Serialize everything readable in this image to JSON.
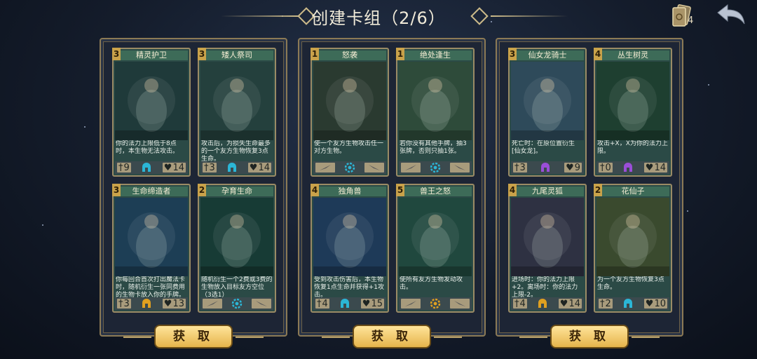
{
  "header": {
    "title": "创建卡组（2/6）",
    "deck_count": "4"
  },
  "colors": {
    "accent_gold": "#e5b44b",
    "card_frame": "#9a8b65",
    "blue_class": "#2bb6d6",
    "orange_class": "#e0a020",
    "purple_class": "#9a4ed8"
  },
  "decks": [
    {
      "button_label": "获 取",
      "cards": [
        {
          "cost": "3",
          "name": "精灵护卫",
          "text": "你的法力上限低于8点时，本生物无法攻击。",
          "attack": "9",
          "class_icon": "blue-helmet-icon",
          "health": "14"
        },
        {
          "cost": "3",
          "name": "矮人祭司",
          "text": "攻击后，为损失生命最多的一个友方生物恢复3点生命。",
          "attack": "3",
          "class_icon": "blue-helmet-icon",
          "health": "14"
        },
        {
          "cost": "3",
          "name": "生命缔造者",
          "text": "你每回合首次打出魔法卡时，随机衍生一张同费用的生物卡放入你的手牌。",
          "attack": "3",
          "class_icon": "orange-helmet-icon",
          "health": "13"
        },
        {
          "cost": "2",
          "name": "孕育生命",
          "text": "随机衍生一个2费或3费的生物放入目标友方空位（3选1）",
          "spell": true,
          "class_icon": "blue-gear-icon"
        }
      ]
    },
    {
      "button_label": "获 取",
      "cards": [
        {
          "cost": "1",
          "name": "怒袭",
          "text": "使一个友方生物攻击任一对方生物。",
          "spell": true,
          "class_icon": "blue-gear-icon"
        },
        {
          "cost": "1",
          "name": "绝处逢生",
          "text": "若你没有其他手牌，抽3张牌，否则只抽1张。",
          "spell": true,
          "class_icon": "blue-gear-icon"
        },
        {
          "cost": "4",
          "name": "独角兽",
          "text": "受到攻击伤害后，本生物恢复1点生命并获得+1攻击。",
          "attack": "4",
          "class_icon": "blue-helmet-icon",
          "health": "15"
        },
        {
          "cost": "5",
          "name": "兽王之怒",
          "text": "使所有友方生物发动攻击。",
          "spell": true,
          "class_icon": "orange-gear-icon"
        }
      ]
    },
    {
      "button_label": "获 取",
      "cards": [
        {
          "cost": "3",
          "name": "仙女龙骑士",
          "text": "死亡时：在原位置衍生[仙女龙]。",
          "attack": "3",
          "class_icon": "purple-helmet-icon",
          "health": "9"
        },
        {
          "cost": "4",
          "name": "丛生树灵",
          "text": "攻击+X，X为你的法力上限。",
          "attack": "0",
          "class_icon": "purple-helmet-icon",
          "health": "14"
        },
        {
          "cost": "4",
          "name": "九尾灵狐",
          "text": "进场时：你的法力上限+2。离场时：你的法力上限-2。",
          "attack": "4",
          "class_icon": "orange-helmet-icon",
          "health": "14"
        },
        {
          "cost": "2",
          "name": "花仙子",
          "text": "为一个友方生物恢复3点生命。",
          "attack": "2",
          "class_icon": "blue-helmet-icon",
          "health": "10"
        }
      ]
    }
  ]
}
